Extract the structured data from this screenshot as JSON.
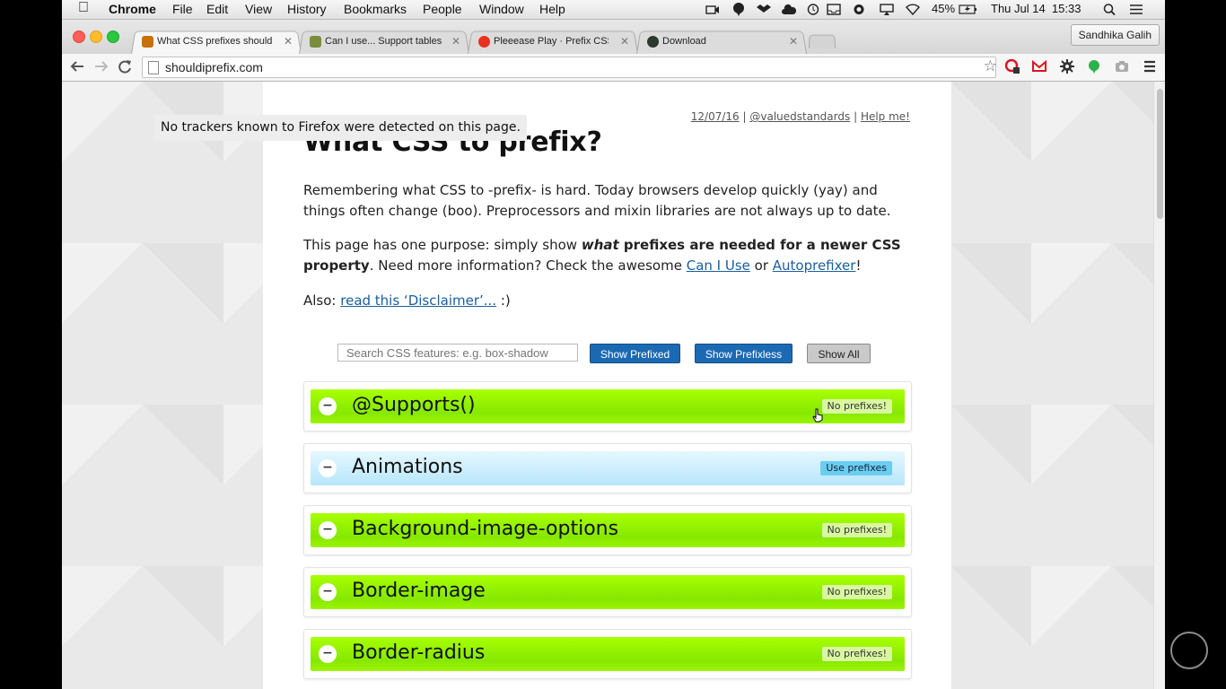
{
  "menubar": {
    "app": "Chrome",
    "menus": [
      "File",
      "Edit",
      "View",
      "History",
      "Bookmarks",
      "People",
      "Window",
      "Help"
    ],
    "battery": "45%",
    "datetime": "Thu Jul 14  15:33"
  },
  "tabs": [
    {
      "title": "What CSS prefixes should",
      "favicon_color": "#c8700a",
      "active": true
    },
    {
      "title": "Can I use... Support tables",
      "favicon_color": "#7a8d3a",
      "active": false
    },
    {
      "title": "Pleeease Play · Prefix CSS",
      "favicon_color": "#e8321e",
      "active": false
    },
    {
      "title": "Download",
      "favicon_color": "#2b3a2b",
      "active": false
    }
  ],
  "profile_name": "Sandhika Galih",
  "address": {
    "url": "shouldiprefix.com"
  },
  "page": {
    "topnav": {
      "date": "12/07/16",
      "sep1": "|",
      "twitter": "@valuedstandards",
      "sep2": "|",
      "help": "Help me!"
    },
    "tooltip": "No trackers known to Firefox were detected on this page.",
    "title": "What CSS to prefix?",
    "intro1": "Remembering what CSS to -prefix- is hard. Today browsers develop quickly (yay) and things often change (boo). Preprocessors and mixin libraries are not always up to date.",
    "intro2": {
      "a": "This page has one purpose: simply show ",
      "b": "what",
      "c": " prefixes are needed for a newer CSS property",
      "d": ". Need more information? Check the awesome ",
      "link1": "Can I Use",
      "e": " or ",
      "link2": "Autoprefixer",
      "f": "!"
    },
    "also": {
      "label": "Also: ",
      "link": "read this ‘Disclaimer’...",
      "tail": " :)"
    },
    "search_placeholder": "Search CSS features: e.g. box-shadow",
    "buttons": {
      "prefixed": "Show Prefixed",
      "prefixless": "Show Prefixless",
      "all": "Show All"
    },
    "features": [
      {
        "name": "@Supports()",
        "badge": "No prefixes!",
        "status": "none"
      },
      {
        "name": "Animations",
        "badge": "Use prefixes",
        "status": "prefix"
      },
      {
        "name": "Background-image-options",
        "badge": "No prefixes!",
        "status": "none"
      },
      {
        "name": "Border-image",
        "badge": "No prefixes!",
        "status": "none"
      },
      {
        "name": "Border-radius",
        "badge": "No prefixes!",
        "status": "none"
      }
    ],
    "toggle_symbol": "−"
  }
}
